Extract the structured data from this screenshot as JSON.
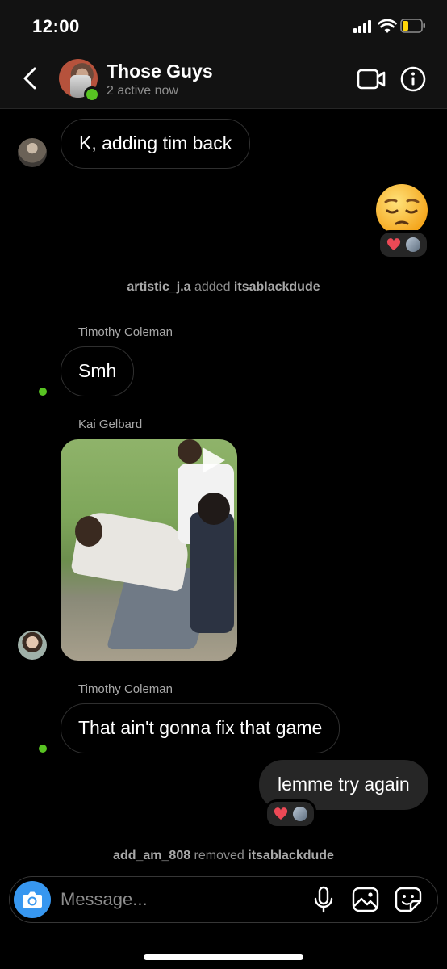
{
  "status_bar": {
    "time": "12:00"
  },
  "header": {
    "title": "Those Guys",
    "subtitle": "2 active now"
  },
  "messages": {
    "m1": "K, adding tim back",
    "system1": {
      "actor": "artistic_j.a",
      "action": " added ",
      "target": "itsablackdude"
    },
    "sender_timothy_1": "Timothy Coleman",
    "m2": "Smh",
    "sender_kai": "Kai Gelbard",
    "sender_timothy_2": "Timothy Coleman",
    "m3": "That ain't gonna fix that game",
    "m4": "lemme try again",
    "system2": {
      "actor": "add_am_808",
      "action": " removed ",
      "target": "itsablackdude"
    }
  },
  "composer": {
    "placeholder": "Message..."
  },
  "colors": {
    "accent": "#3797f0",
    "online": "#58c322",
    "reaction_heart": "#ed4956"
  }
}
